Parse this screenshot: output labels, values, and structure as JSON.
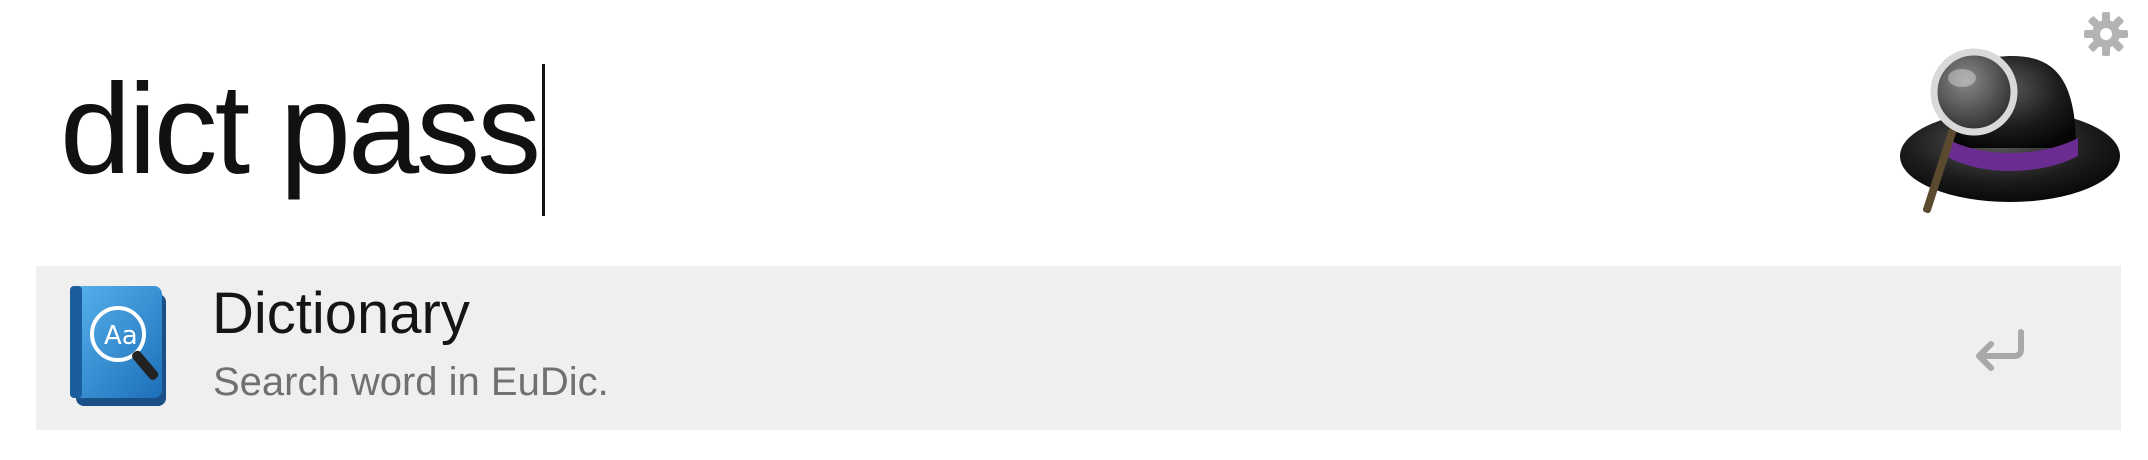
{
  "search": {
    "query": "dict pass"
  },
  "results": [
    {
      "title": "Dictionary",
      "subtitle": "Search word in EuDic.",
      "icon": "dictionary-book-icon",
      "action_icon": "return-key-icon"
    }
  ],
  "icons": {
    "settings": "gear-icon",
    "app_logo": "alfred-hat-magnifier-icon"
  },
  "colors": {
    "background": "#ffffff",
    "selected_row": "#efefef",
    "title_text": "#151515",
    "subtitle_text": "#707070",
    "icon_gray": "#b3b3b3",
    "book_blue": "#2f8fd6",
    "hat_band_purple": "#6b2c91"
  }
}
